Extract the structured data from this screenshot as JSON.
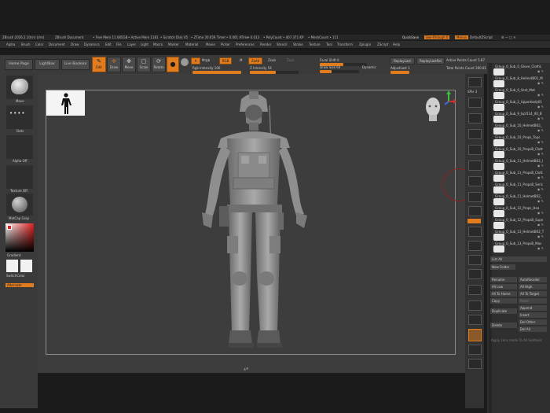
{
  "window": {
    "title_items": [
      "ZBrush 2026.2.1(trn) (r/m)",
      "ZBrush Document",
      "• Free Mem 11.085GB",
      "• Active Mem 1181",
      "• Scratch Disk 45",
      "• ZTime 30.659 Timer",
      "• 0.001 ATime",
      "• 0.013",
      "• PolyCount • 407.371 KP",
      "• MeshCount • 111"
    ],
    "quicksave": "QuickSave",
    "seethrough": "See-through 0",
    "menus_btn": "Menus",
    "default_zscript": "DefaultZScript"
  },
  "menubar": [
    "Alpha",
    "Brush",
    "Color",
    "Document",
    "Draw",
    "Dynamics",
    "Edit",
    "File",
    "Layer",
    "Light",
    "Macro",
    "Marker",
    "Material",
    "Movie",
    "Picker",
    "Preferences",
    "Render",
    "Stencil",
    "Stroke",
    "Texture",
    "Tool",
    "Transform",
    "Zplugin",
    "ZScript",
    "Help"
  ],
  "toolbar": {
    "home_page": "Home Page",
    "lightbox": "LightBox",
    "live_boolean": "Live Boolean",
    "edit": "Edit",
    "draw": "Draw",
    "move": "Move",
    "scale": "Scale",
    "rotate": "Rotate",
    "a_label": "A",
    "mrgb": "Mrgb",
    "rgb": "RGB",
    "m": "M",
    "zadd": "Zadd",
    "zsub": "Zsub",
    "zcut": "Zcut",
    "rgb_intensity": "Rgb Intensity 100",
    "rgb_intensity_value": 1.0,
    "z_intensity": "Z Intensity 54",
    "z_intensity_value": 0.54,
    "focal_shift": "Focal Shift 0",
    "focal_shift_value": 0.5,
    "draw_size": "Draw Size 64",
    "draw_size_value": 0.3,
    "dynamic": "Dynamic",
    "replay_last": "ReplayLast",
    "replay_last_rel": "ReplayLastRel",
    "adjust_last": "AdjustLast 1",
    "active_points": "Active Points Count 5.87",
    "total_points": "Total Points Count 300.81"
  },
  "left_shelf": {
    "move": "Move",
    "dots": "Dots",
    "alpha_off": "Alpha Off",
    "texture_off": "Texture Off",
    "matcap": "MatCap Gray",
    "gradient": "Gradient",
    "switch_color": "SwitchColor",
    "alternate": "Alternate"
  },
  "right_shelf": [
    "BPR",
    "SPix 3",
    "Scroll",
    "Zoom",
    "Actual",
    "AAHalf",
    "Persp",
    "Floor",
    "L.Sym",
    "Dynamic",
    "Xpose",
    "Frame",
    "Move",
    "Scale",
    "Rotate",
    "Line Fill",
    "PolyF",
    "Transp",
    "Ghost",
    "Solo"
  ],
  "subtools": [
    "Group_0_Sub_0_Glove_ClothL",
    "Group_0_Sub_8_HelmetB01_M",
    "Group_0_Sub_0_Vest_Mat",
    "Group_0_Sub_2_Upperbody01",
    "Group_0_Sub_9_Ispf114_00_B",
    "Group_0_Sub_10_HelmetB02_",
    "Group_0_Sub_10_Props_Tops",
    "Group_0_Sub_10_PropsB_Clott",
    "Group_0_Sub_11_HelmetB02_I",
    "Group_0_Sub_11_PropsB_Clott",
    "Group_0_Sub_11_PropsB_Seric",
    "Group_0_Sub_11_HelmetB02_",
    "Group_0_Sub_12_Props_Hea",
    "Group_0_Sub_12_PropsB_Supe",
    "Group_0_Sub_13_HelmetB02_T",
    "Group_0_Sub_13_PropsB_Mas"
  ],
  "subtool_actions": {
    "list_all": "List All",
    "new_folder": "New Folder",
    "rename": "Rename",
    "autoreorder": "AutoReorder",
    "all_low": "All Low",
    "all_high": "All High",
    "all_to_home": "All To Home",
    "all_to_target": "All To Target",
    "copy": "Copy",
    "paste": "Paste",
    "append": "Append",
    "duplicate": "Duplicate",
    "insert": "Insert",
    "delete": "Delete",
    "del_other": "Del Other",
    "del_all": "Del All",
    "apply": "Apply Lens mode To All Subtools"
  },
  "colors": {
    "accent": "#e07b1e",
    "panel": "#3a3a3a",
    "viewport": "#3d3d3d",
    "background": "#1b1b1b",
    "gizmo_red": "#d23030",
    "gizmo_green": "#3cbf3c",
    "gizmo_blue": "#3a6fe0"
  }
}
